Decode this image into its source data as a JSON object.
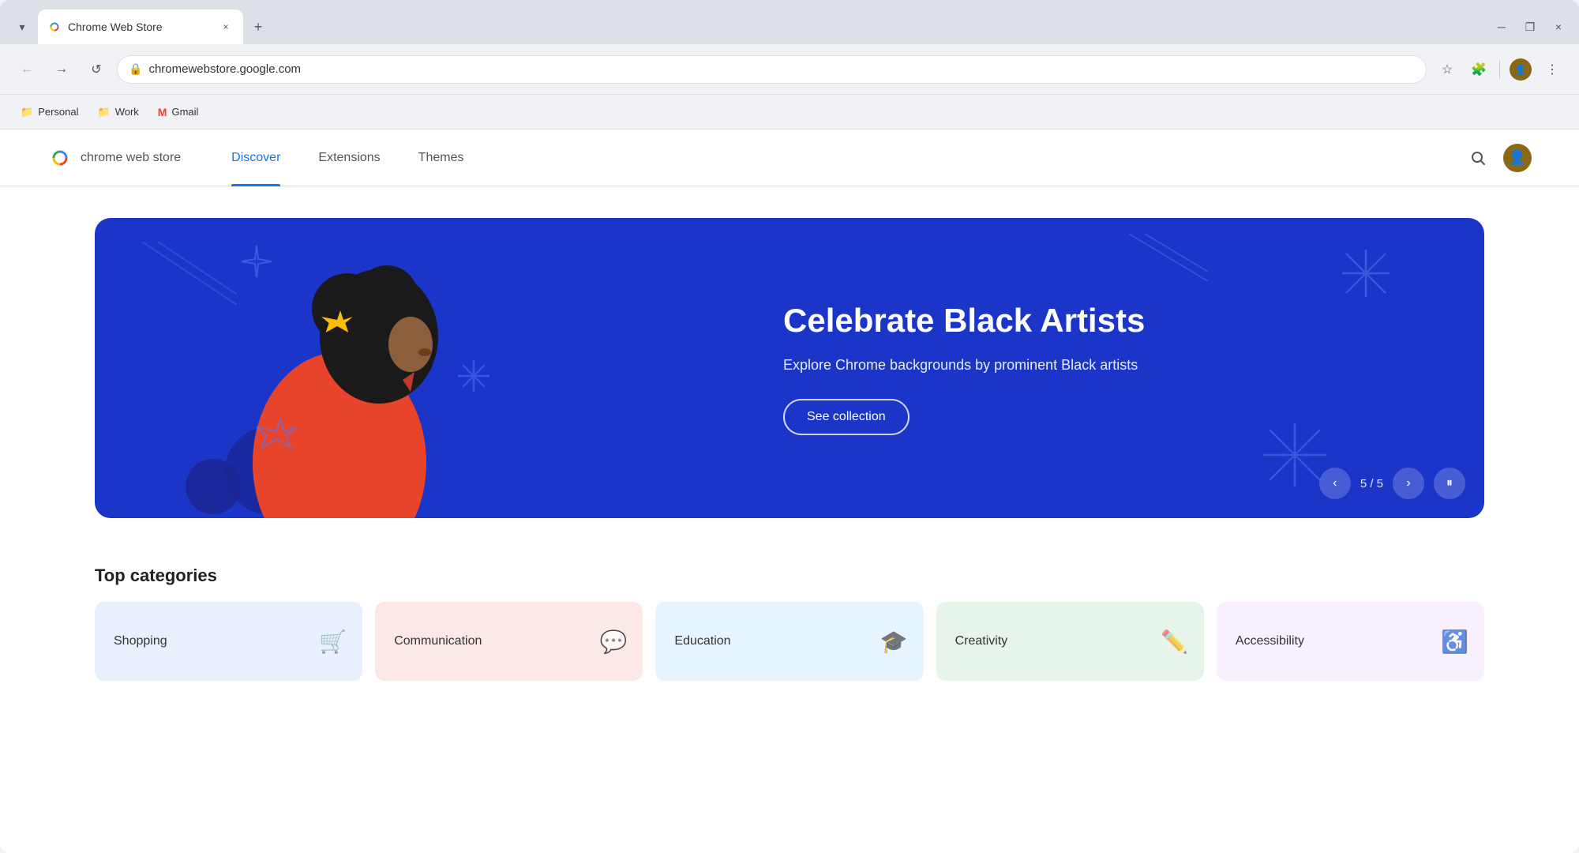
{
  "browser": {
    "tab": {
      "favicon": "🌐",
      "title": "Chrome Web Store",
      "close": "×"
    },
    "new_tab": "+",
    "window_buttons": {
      "minimize": "─",
      "maximize": "❐",
      "close": "×"
    },
    "address": "chromewebstore.google.com",
    "bookmarks": [
      {
        "id": "personal",
        "icon": "📁",
        "label": "Personal"
      },
      {
        "id": "work",
        "icon": "📁",
        "label": "Work"
      },
      {
        "id": "gmail",
        "icon": "M",
        "label": "Gmail"
      }
    ]
  },
  "store": {
    "logo": {
      "alt": "Chrome Web Store",
      "name": "chrome web store"
    },
    "nav": [
      {
        "id": "discover",
        "label": "Discover",
        "active": true
      },
      {
        "id": "extensions",
        "label": "Extensions",
        "active": false
      },
      {
        "id": "themes",
        "label": "Themes",
        "active": false
      }
    ]
  },
  "hero": {
    "title": "Celebrate Black Artists",
    "subtitle": "Explore Chrome backgrounds by prominent Black artists",
    "cta_label": "See collection",
    "counter": "5 / 5",
    "prev_label": "‹",
    "next_label": "›",
    "pause_label": "⏸"
  },
  "categories": {
    "section_title": "Top categories",
    "items": [
      {
        "id": "shopping",
        "label": "Shopping",
        "icon": "🛒",
        "color": "cat-shopping"
      },
      {
        "id": "communication",
        "label": "Communication",
        "icon": "💬",
        "color": "cat-communication"
      },
      {
        "id": "education",
        "label": "Education",
        "icon": "🎓",
        "color": "cat-education"
      },
      {
        "id": "creativity",
        "label": "Creativity",
        "icon": "✏️",
        "color": "cat-creativity"
      },
      {
        "id": "accessibility",
        "label": "Accessibility",
        "icon": "♿",
        "color": "cat-accessibility"
      }
    ]
  }
}
